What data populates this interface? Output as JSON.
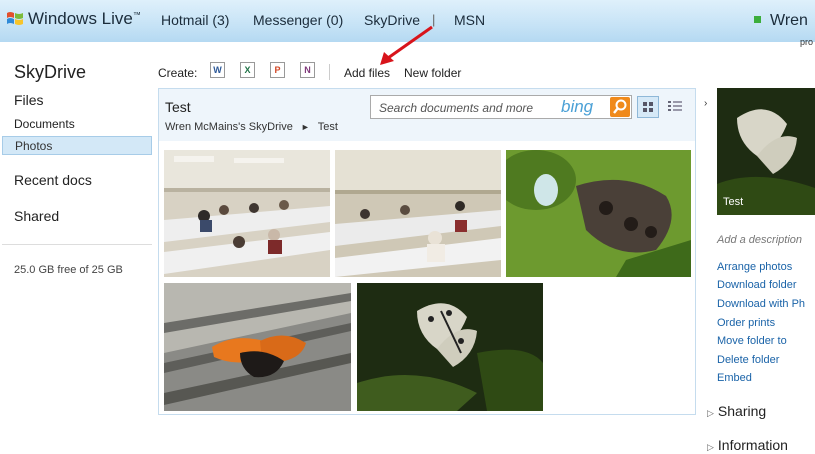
{
  "topbar": {
    "brand": "Windows Live",
    "brand_tm": "™",
    "nav": [
      {
        "label": "Hotmail (3)"
      },
      {
        "label": "Messenger (0)"
      },
      {
        "label": "SkyDrive"
      },
      {
        "label": "MSN"
      }
    ],
    "separator": "|",
    "user_name": "Wren",
    "user_sub": "pro"
  },
  "sidebar": {
    "title": "SkyDrive",
    "files": "Files",
    "documents": "Documents",
    "photos": "Photos",
    "recent": "Recent docs",
    "shared": "Shared",
    "storage": "25.0 GB free of 25 GB"
  },
  "toolbar": {
    "create_label": "Create:",
    "icons": [
      {
        "name": "word-doc-icon",
        "letter": "W",
        "color": "#2b5797"
      },
      {
        "name": "excel-doc-icon",
        "letter": "X",
        "color": "#1e7145"
      },
      {
        "name": "powerpoint-doc-icon",
        "letter": "P",
        "color": "#d24726"
      },
      {
        "name": "onenote-doc-icon",
        "letter": "N",
        "color": "#80397b"
      }
    ],
    "add_files": "Add files",
    "new_folder": "New folder"
  },
  "panel": {
    "title": "Test",
    "breadcrumb_root": "Wren McMains's SkyDrive",
    "breadcrumb_sep": "►",
    "breadcrumb_current": "Test",
    "search_placeholder": "Search documents and more",
    "search_brand": "bing"
  },
  "photos": [
    {
      "name": "photo-classroom-1"
    },
    {
      "name": "photo-classroom-2"
    },
    {
      "name": "photo-owl-butterfly"
    },
    {
      "name": "photo-orange-butterfly"
    },
    {
      "name": "photo-paper-kite-butterfly"
    }
  ],
  "details": {
    "thumb_caption": "Test",
    "add_description": "Add a description",
    "links": [
      "Arrange photos",
      "Download folder",
      "Download with Ph",
      "Order prints",
      "Move folder to",
      "Delete folder",
      "Embed"
    ],
    "sharing": "Sharing",
    "information": "Information"
  },
  "colors": {
    "accent_link": "#1a63a8",
    "selection": "#d3e8f7",
    "annotation_arrow": "#d8141b"
  }
}
